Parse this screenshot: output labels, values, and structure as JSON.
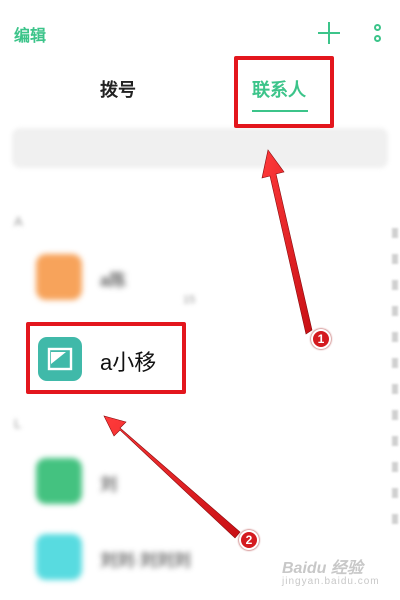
{
  "header": {
    "edit_label": "编辑",
    "add_icon": "plus-icon",
    "more_icon": "more-vertical-icon"
  },
  "tabs": [
    {
      "label": "拨号",
      "active": false
    },
    {
      "label": "联系人",
      "active": true
    }
  ],
  "colors": {
    "accent": "#3cc48a",
    "annotation_red": "#e3161d",
    "highlight_avatar": "#40b9a9"
  },
  "contacts": {
    "highlighted": {
      "name": "a小移",
      "avatar_icon": "contact-card-icon",
      "avatar_color": "#40b9a9"
    },
    "blurred_avatar_colors": [
      "#f7a35b",
      "#44c280",
      "#58dbe0"
    ]
  },
  "annotations": [
    {
      "number": "1",
      "target": "contacts-tab"
    },
    {
      "number": "2",
      "target": "contact-a-xiaoyi"
    }
  ]
}
